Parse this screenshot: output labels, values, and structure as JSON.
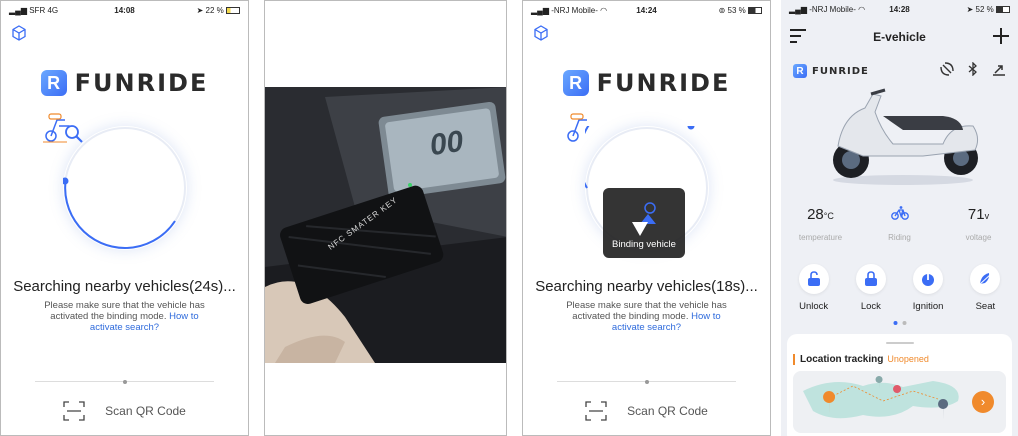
{
  "screen1": {
    "status": {
      "carrier": "SFR",
      "network": "4G",
      "time": "14:08",
      "battery": "22 %"
    },
    "brand": "FUNRIDE",
    "brand_letter": "R",
    "search_title": "Searching nearby vehicles(24s)...",
    "search_desc": "Please make sure that the vehicle has activated the binding mode.",
    "search_link": "How to activate search?",
    "qr_label": "Scan QR Code"
  },
  "screen2": {
    "card_text": "NFC SMATER KEY",
    "dash_reading": "00"
  },
  "screen3": {
    "status": {
      "carrier": "-NRJ Mobile-",
      "time": "14:24",
      "battery": "53 %"
    },
    "brand": "FUNRIDE",
    "brand_letter": "R",
    "search_title": "Searching nearby vehicles(18s)...",
    "search_desc": "Please make sure that the vehicle has activated the binding mode.",
    "search_link": "How to activate search?",
    "toast": "Binding vehicle",
    "qr_label": "Scan QR Code"
  },
  "screen4": {
    "status": {
      "carrier": "-NRJ Mobile-",
      "time": "14:28",
      "battery": "52 %"
    },
    "title": "E-vehicle",
    "brand": "FUNRIDE",
    "brand_letter": "R",
    "stats": {
      "temperature": {
        "value": "28",
        "unit": "°C",
        "label": "temperature"
      },
      "riding": {
        "label": "Riding"
      },
      "voltage": {
        "value": "71",
        "unit": "v",
        "label": "voltage"
      }
    },
    "controls": [
      "Unlock",
      "Lock",
      "Ignition",
      "Seat"
    ],
    "location": {
      "title": "Location tracking",
      "status": "Unopened"
    },
    "colors": {
      "accent": "#3b6df5",
      "orange": "#f08a2c"
    }
  }
}
